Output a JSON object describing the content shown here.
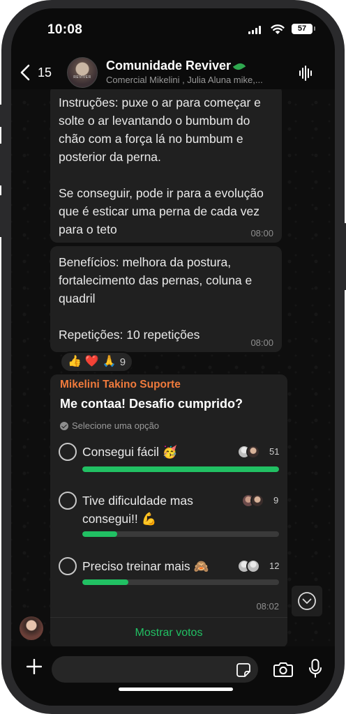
{
  "status_bar": {
    "time": "10:08",
    "battery": "57"
  },
  "header": {
    "back_count": "15",
    "avatar_caption": "REVIVER",
    "title": "Comunidade Reviver",
    "subtitle": "Comercial Mikelini , Julia Aluna mike,..."
  },
  "messages": [
    {
      "paragraphs": [
        "Instruções: puxe o ar para começar e solte o ar levantando o bumbum do chão com a força lá no bumbum e posterior da perna.",
        "Se conseguir, pode ir para a evolução que é esticar uma perna de cada vez para o teto"
      ],
      "time": "08:00"
    },
    {
      "paragraphs": [
        "Benefícios: melhora da postura, fortalecimento das pernas, coluna e quadril",
        "Repetições: 10 repetições"
      ],
      "time": "08:00",
      "reactions": {
        "emojis": [
          "👍",
          "❤️",
          "🙏"
        ],
        "count": "9"
      }
    }
  ],
  "poll": {
    "sender": "Mikelini Takino Suporte",
    "question": "Me contaa! Desafio cumprido?",
    "hint": "Selecione uma opção",
    "options": [
      {
        "text": "Consegui fácil 🥳",
        "votes": "51",
        "fraction": 1.0
      },
      {
        "text": "Tive dificuldade mas consegui!! 💪",
        "votes": "9",
        "fraction": 0.176
      },
      {
        "text": "Preciso treinar mais 🙈",
        "votes": "12",
        "fraction": 0.235
      }
    ],
    "time": "08:02",
    "show_votes": "Mostrar votos"
  },
  "input": {
    "placeholder": ""
  },
  "colors": {
    "accent": "#21c063",
    "sender": "#ef7a3c",
    "bubble": "#202020"
  },
  "icons": [
    "back-icon",
    "audio-wave-icon",
    "check-circle-icon",
    "chevron-down-icon",
    "plus-icon",
    "sticker-icon",
    "camera-icon",
    "mic-icon"
  ]
}
